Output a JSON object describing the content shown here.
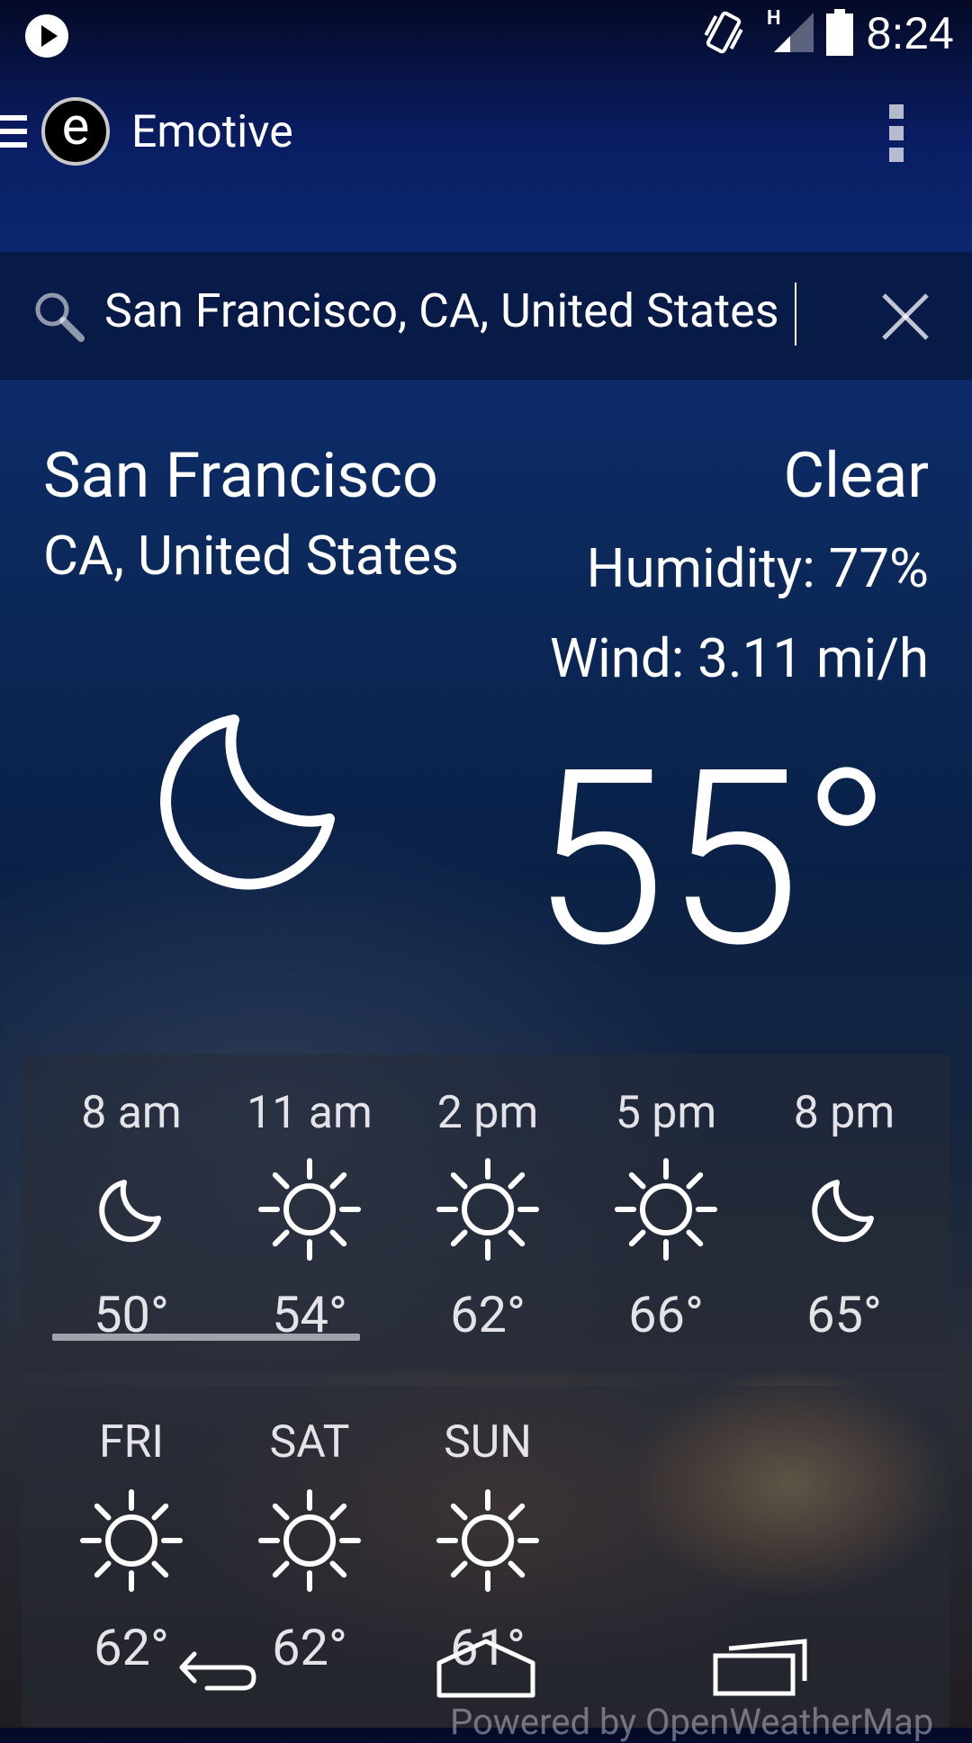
{
  "status_bar": {
    "time": "8:24",
    "network": "H"
  },
  "app_bar": {
    "title": "Emotive",
    "logo_letter": "e"
  },
  "search": {
    "value": "San Francisco, CA, United States"
  },
  "current": {
    "city": "San Francisco",
    "region": "CA, United States",
    "condition": "Clear",
    "humidity": "Humidity: 77%",
    "wind": "Wind: 3.11 mi/h",
    "temperature": "55°",
    "icon": "moon-icon"
  },
  "hourly": [
    {
      "time": "8 am",
      "icon": "moon-icon",
      "temp": "50°"
    },
    {
      "time": "11 am",
      "icon": "sun-icon",
      "temp": "54°"
    },
    {
      "time": "2 pm",
      "icon": "sun-icon",
      "temp": "62°"
    },
    {
      "time": "5 pm",
      "icon": "sun-icon",
      "temp": "66°"
    },
    {
      "time": "8 pm",
      "icon": "moon-icon",
      "temp": "65°"
    }
  ],
  "daily": [
    {
      "day": "FRI",
      "icon": "sun-icon",
      "temp": "62°"
    },
    {
      "day": "SAT",
      "icon": "sun-icon",
      "temp": "62°"
    },
    {
      "day": "SUN",
      "icon": "sun-icon",
      "temp": "61°"
    }
  ],
  "footer": {
    "powered_by": "Powered by OpenWeatherMap"
  }
}
